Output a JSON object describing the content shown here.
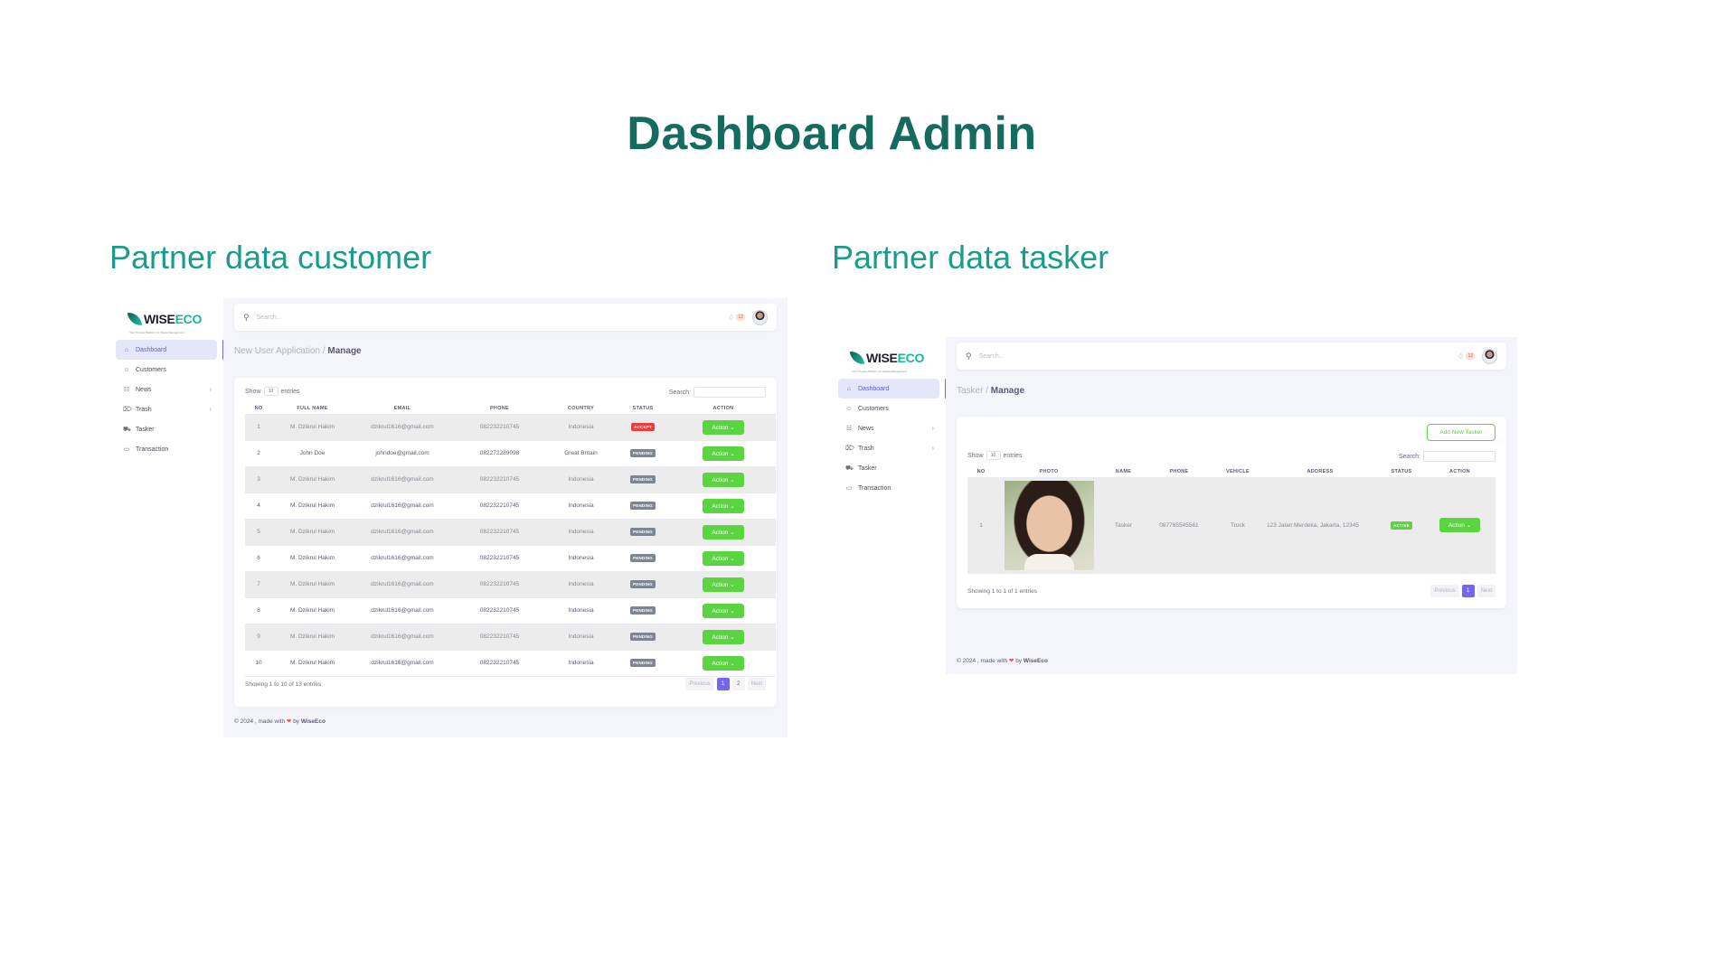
{
  "title": "Dashboard Admin",
  "sections": {
    "left_title": "Partner data customer",
    "right_title": "Partner data tasker"
  },
  "app": {
    "logo_wise": "WISE",
    "logo_eco": "ECO",
    "logo_tagline": "Your Trusted Platform for Waste Management",
    "search_placeholder": "Search...",
    "notif_count": "12",
    "nav": [
      {
        "label": "Dashboard",
        "icon": "home-icon",
        "active": true
      },
      {
        "label": "Customers",
        "icon": "user-icon"
      },
      {
        "label": "News",
        "icon": "news-icon",
        "chevron": true
      },
      {
        "label": "Trash",
        "icon": "trash-icon",
        "chevron": true
      },
      {
        "label": "Tasker",
        "icon": "truck-icon"
      },
      {
        "label": "Transaction",
        "icon": "card-icon"
      }
    ],
    "footer_prefix": "© 2024 , made with",
    "footer_by": "by",
    "footer_brand": "WiseEco",
    "show_label": "Show",
    "show_value": "10",
    "entries_label": "entries",
    "search_label": "Search:",
    "previous": "Previous",
    "next": "Next",
    "action_label": "Action"
  },
  "customer_view": {
    "crumb_parent": "New User Application /",
    "crumb_current": "Manage",
    "columns": [
      "NO",
      "FULL NAME",
      "EMAIL",
      "PHONE",
      "COUNTRY",
      "STATUS",
      "ACTION"
    ],
    "rows": [
      {
        "no": "1",
        "name": "M. Dzikrul Hakim",
        "email": "dzikrul1616@gmail.com",
        "phone": "082232210745",
        "country": "Indonesia",
        "status": "ACCEPT"
      },
      {
        "no": "2",
        "name": "John Doe",
        "email": "johndoe@gmail.com",
        "phone": "082272289098",
        "country": "Great Britain",
        "status": "PENDING"
      },
      {
        "no": "3",
        "name": "M. Dzikrul Hakim",
        "email": "dzikrul1616@gmail.com",
        "phone": "082232210745",
        "country": "Indonesia",
        "status": "PENDING"
      },
      {
        "no": "4",
        "name": "M. Dzikrul Hakim",
        "email": "dzikrul1616@gmail.com",
        "phone": "082232210745",
        "country": "Indonesia",
        "status": "PENDING"
      },
      {
        "no": "5",
        "name": "M. Dzikrul Hakim",
        "email": "dzikrul1616@gmail.com",
        "phone": "082232210745",
        "country": "Indonesia",
        "status": "PENDING"
      },
      {
        "no": "6",
        "name": "M. Dzikrul Hakim",
        "email": "dzikrul1616@gmail.com",
        "phone": "082232210745",
        "country": "Indonesia",
        "status": "PENDING"
      },
      {
        "no": "7",
        "name": "M. Dzikrul Hakim",
        "email": "dzikrul1616@gmail.com",
        "phone": "082232210745",
        "country": "Indonesia",
        "status": "PENDING"
      },
      {
        "no": "8",
        "name": "M. Dzikrul Hakim",
        "email": "dzikrul1616@gmail.com",
        "phone": "082232210745",
        "country": "Indonesia",
        "status": "PENDING"
      },
      {
        "no": "9",
        "name": "M. Dzikrul Hakim",
        "email": "dzikrul1616@gmail.com",
        "phone": "082232210745",
        "country": "Indonesia",
        "status": "PENDING"
      },
      {
        "no": "10",
        "name": "M. Dzikrul Hakim",
        "email": "dzikrul1616@gmail.com",
        "phone": "082232210745",
        "country": "Indonesia",
        "status": "PENDING"
      }
    ],
    "showing": "Showing 1 to 10 of 13 entries",
    "pages": [
      "1",
      "2"
    ],
    "current_page": "1"
  },
  "tasker_view": {
    "crumb_parent": "Tasker /",
    "crumb_current": "Manage",
    "add_button": "Add New Tasker",
    "columns": [
      "NO",
      "PHOTO",
      "NAME",
      "PHONE",
      "VEHICLE",
      "ADDRESS",
      "STATUS",
      "ACTION"
    ],
    "rows": [
      {
        "no": "1",
        "name": "Tasker",
        "phone": "087765545561",
        "vehicle": "Truck",
        "address": "123 Jalan Merdeka, Jakarta, 12345",
        "status": "ACTIVE"
      }
    ],
    "showing": "Showing 1 to 1 of 1 entries",
    "pages": [
      "1"
    ],
    "current_page": "1"
  }
}
